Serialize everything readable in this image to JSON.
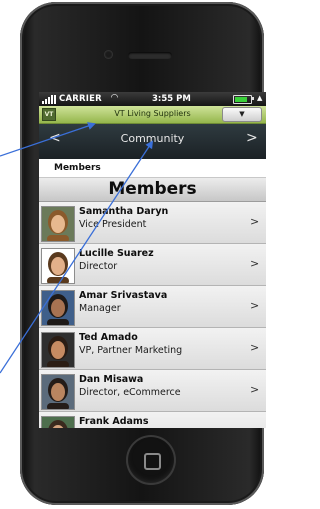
{
  "status_bar": {
    "carrier": "CARRIER",
    "time": "3:55 PM",
    "battery_level": 0.8
  },
  "brand_bar": {
    "logo_text": "VT",
    "title": "VT Living Suppliers",
    "dropdown_symbol": "▼"
  },
  "nav": {
    "title": "Community",
    "prev_symbol": "<",
    "next_symbol": ">",
    "page_count": 6,
    "active_page": 1
  },
  "section": {
    "label": "Members"
  },
  "members": {
    "title": "Members",
    "items": [
      {
        "name": "Samantha Daryn",
        "role": "Vice President"
      },
      {
        "name": "Lucille Suarez",
        "role": "Director"
      },
      {
        "name": "Amar Srivastava",
        "role": "Manager"
      },
      {
        "name": "Ted Amado",
        "role": "VP, Partner Marketing"
      },
      {
        "name": "Dan Misawa",
        "role": "Director, eCommerce"
      },
      {
        "name": "Frank Adams",
        "role": ""
      }
    ],
    "chevron": ">"
  },
  "colors": {
    "brand_green": "#b5d06e",
    "nav_dark": "#232b2f",
    "annotation_blue": "#3a6fd8"
  }
}
